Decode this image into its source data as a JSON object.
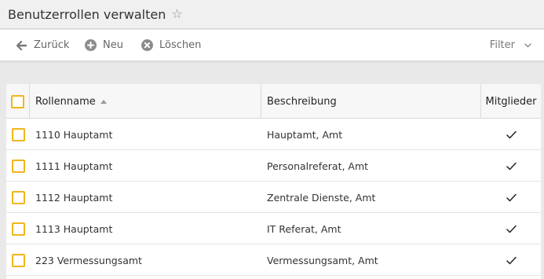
{
  "header": {
    "title": "Benutzerrollen verwalten",
    "favorite_icon": "star-outline-icon"
  },
  "toolbar": {
    "back_label": "Zurück",
    "new_label": "Neu",
    "delete_label": "Löschen",
    "filter_label": "Filter"
  },
  "table": {
    "columns": {
      "name": "Rollenname",
      "description": "Beschreibung",
      "members": "Mitglieder"
    },
    "sort": {
      "column": "name",
      "direction": "ascending"
    },
    "rows": [
      {
        "name": "1110 Hauptamt",
        "description": "Hauptamt, Amt",
        "members": true
      },
      {
        "name": "1111 Hauptamt",
        "description": "Personalreferat, Amt",
        "members": true
      },
      {
        "name": "1112 Hauptamt",
        "description": "Zentrale Dienste, Amt",
        "members": true
      },
      {
        "name": "1113 Hauptamt",
        "description": "IT Referat, Amt",
        "members": true
      },
      {
        "name": "223 Vermessungsamt",
        "description": "Vermessungsamt, Amt",
        "members": true
      }
    ]
  },
  "colors": {
    "checkbox_border": "#f2b51a",
    "titlebar_bg": "#f0f0f0",
    "page_bg": "#e9e9e9"
  }
}
